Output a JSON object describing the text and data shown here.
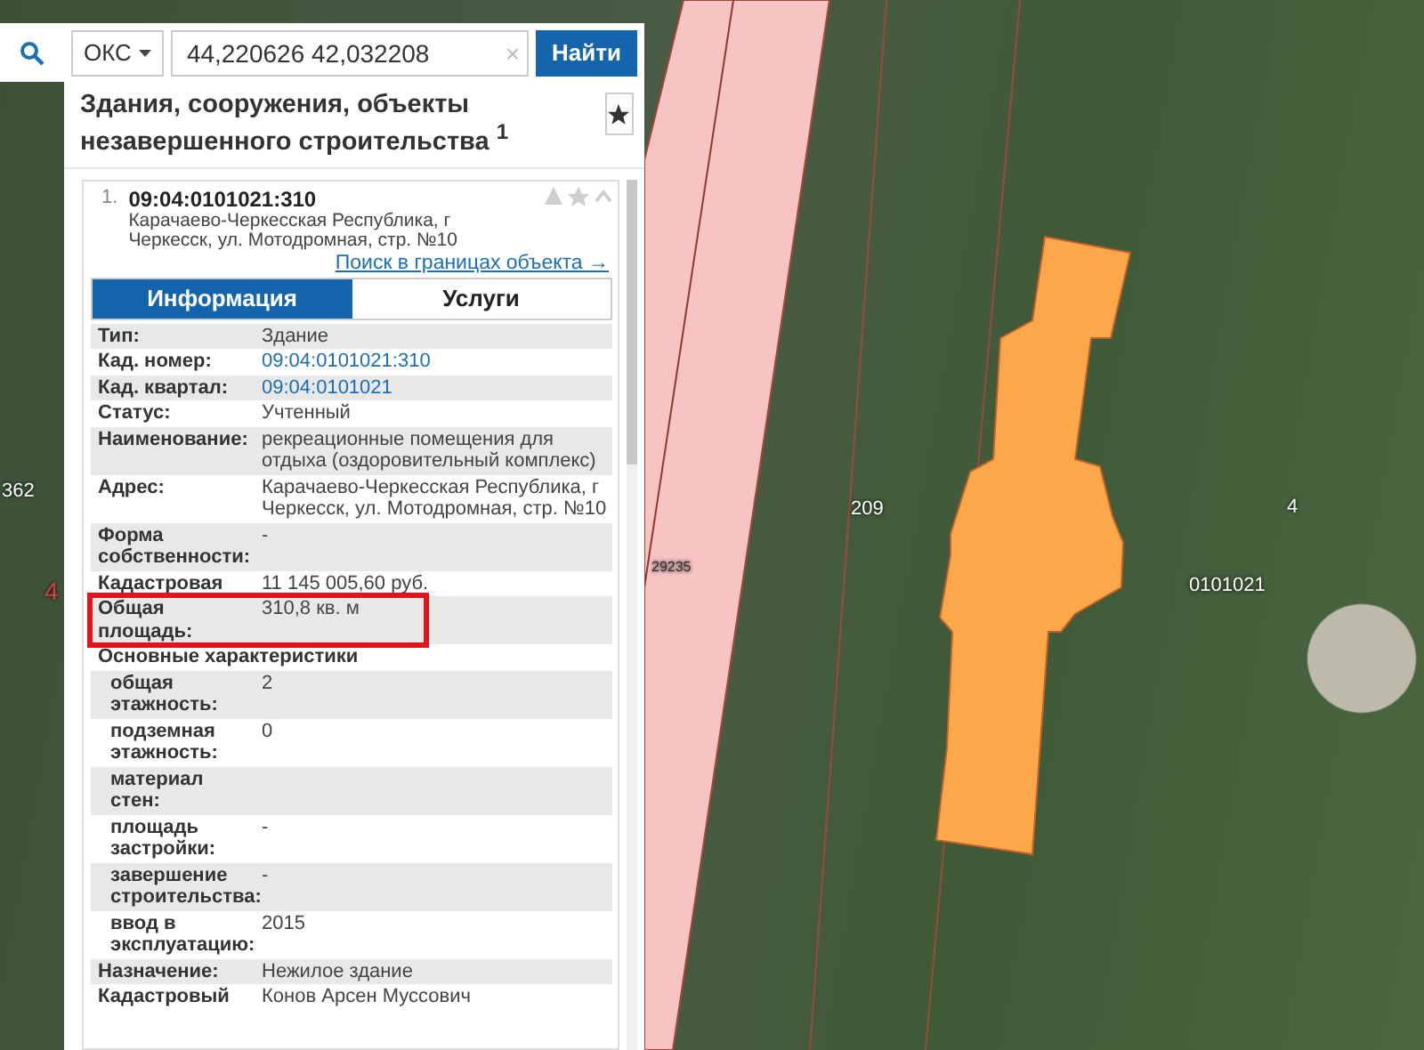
{
  "search": {
    "type_dropdown": "ОКС",
    "query": "44,220626 42,032208",
    "clear": "×",
    "button": "Найти"
  },
  "panel": {
    "title": "Здания, сооружения, объекты незавершенного строительства $^{1}$",
    "result": {
      "index": "1.",
      "cadastral_number": "09:04:0101021:310",
      "address": "Карачаево-Черкесская Республика, г Черкесск, ул. Мотодромная, стр. №10",
      "link": "Поиск в границах объекта →"
    },
    "tabs": [
      {
        "label": "Информация",
        "selected": true
      },
      {
        "label": "Услуги",
        "selected": false
      }
    ],
    "rows": [
      {
        "label": "Тип:",
        "value": "Здание",
        "kind": "text",
        "highlighted": false
      },
      {
        "label": "Кад. номер:",
        "value": "09:04:0101021:310",
        "kind": "link",
        "highlighted": false
      },
      {
        "label": "Кад. квартал:",
        "value": "09:04:0101021",
        "kind": "link",
        "highlighted": false
      },
      {
        "label": "Статус:",
        "value": "Учтенный",
        "kind": "text",
        "highlighted": false
      },
      {
        "label": "Наименование:",
        "value": "рекреационные помещения для отдыха (оздоровительный комплекс)",
        "kind": "text",
        "highlighted": false
      },
      {
        "label": "Адрес:",
        "value": "Карачаево-Черкесская Республика, г Черкесск, ул. Мотодромная, стр. №10",
        "kind": "text",
        "highlighted": false
      },
      {
        "label": "Форма собственности:",
        "value": "-",
        "kind": "text",
        "highlighted": false
      },
      {
        "label": "Кадастровая",
        "value": "11 145 005,60 руб.",
        "kind": "text",
        "highlighted": false
      },
      {
        "label": "Общая площадь:",
        "value": "310,8 кв. м",
        "kind": "text",
        "highlighted": true
      },
      {
        "label": "Основные характеристики",
        "kind": "group",
        "highlighted": false,
        "children": [
          {
            "label": "общая этажность:",
            "value": "2"
          },
          {
            "label": "подземная этажность:",
            "value": "0"
          },
          {
            "label": "материал стен:"
          },
          {
            "label": "площадь застройки:",
            "value": "-"
          },
          {
            "label": "завершение строительства:",
            "value": "-"
          },
          {
            "label": "ввод в эксплуатацию:",
            "value": "2015"
          }
        ]
      },
      {
        "label": "Назначение:",
        "value": "Нежилое здание",
        "kind": "text",
        "highlighted": false
      },
      {
        "label": "Кадастровый",
        "value": "Конов Арсен Муссович",
        "kind": "text",
        "highlighted": false
      }
    ]
  },
  "map_labels": [
    {
      "text": "362",
      "kind": "edge"
    },
    {
      "text": "4",
      "kind": "edge-red"
    },
    {
      "text": "29235",
      "kind": "road"
    },
    {
      "text": "209",
      "kind": "parcel"
    },
    {
      "text": "4",
      "kind": "parcel-right"
    },
    {
      "text": "0101021",
      "kind": "quarter"
    }
  ]
}
